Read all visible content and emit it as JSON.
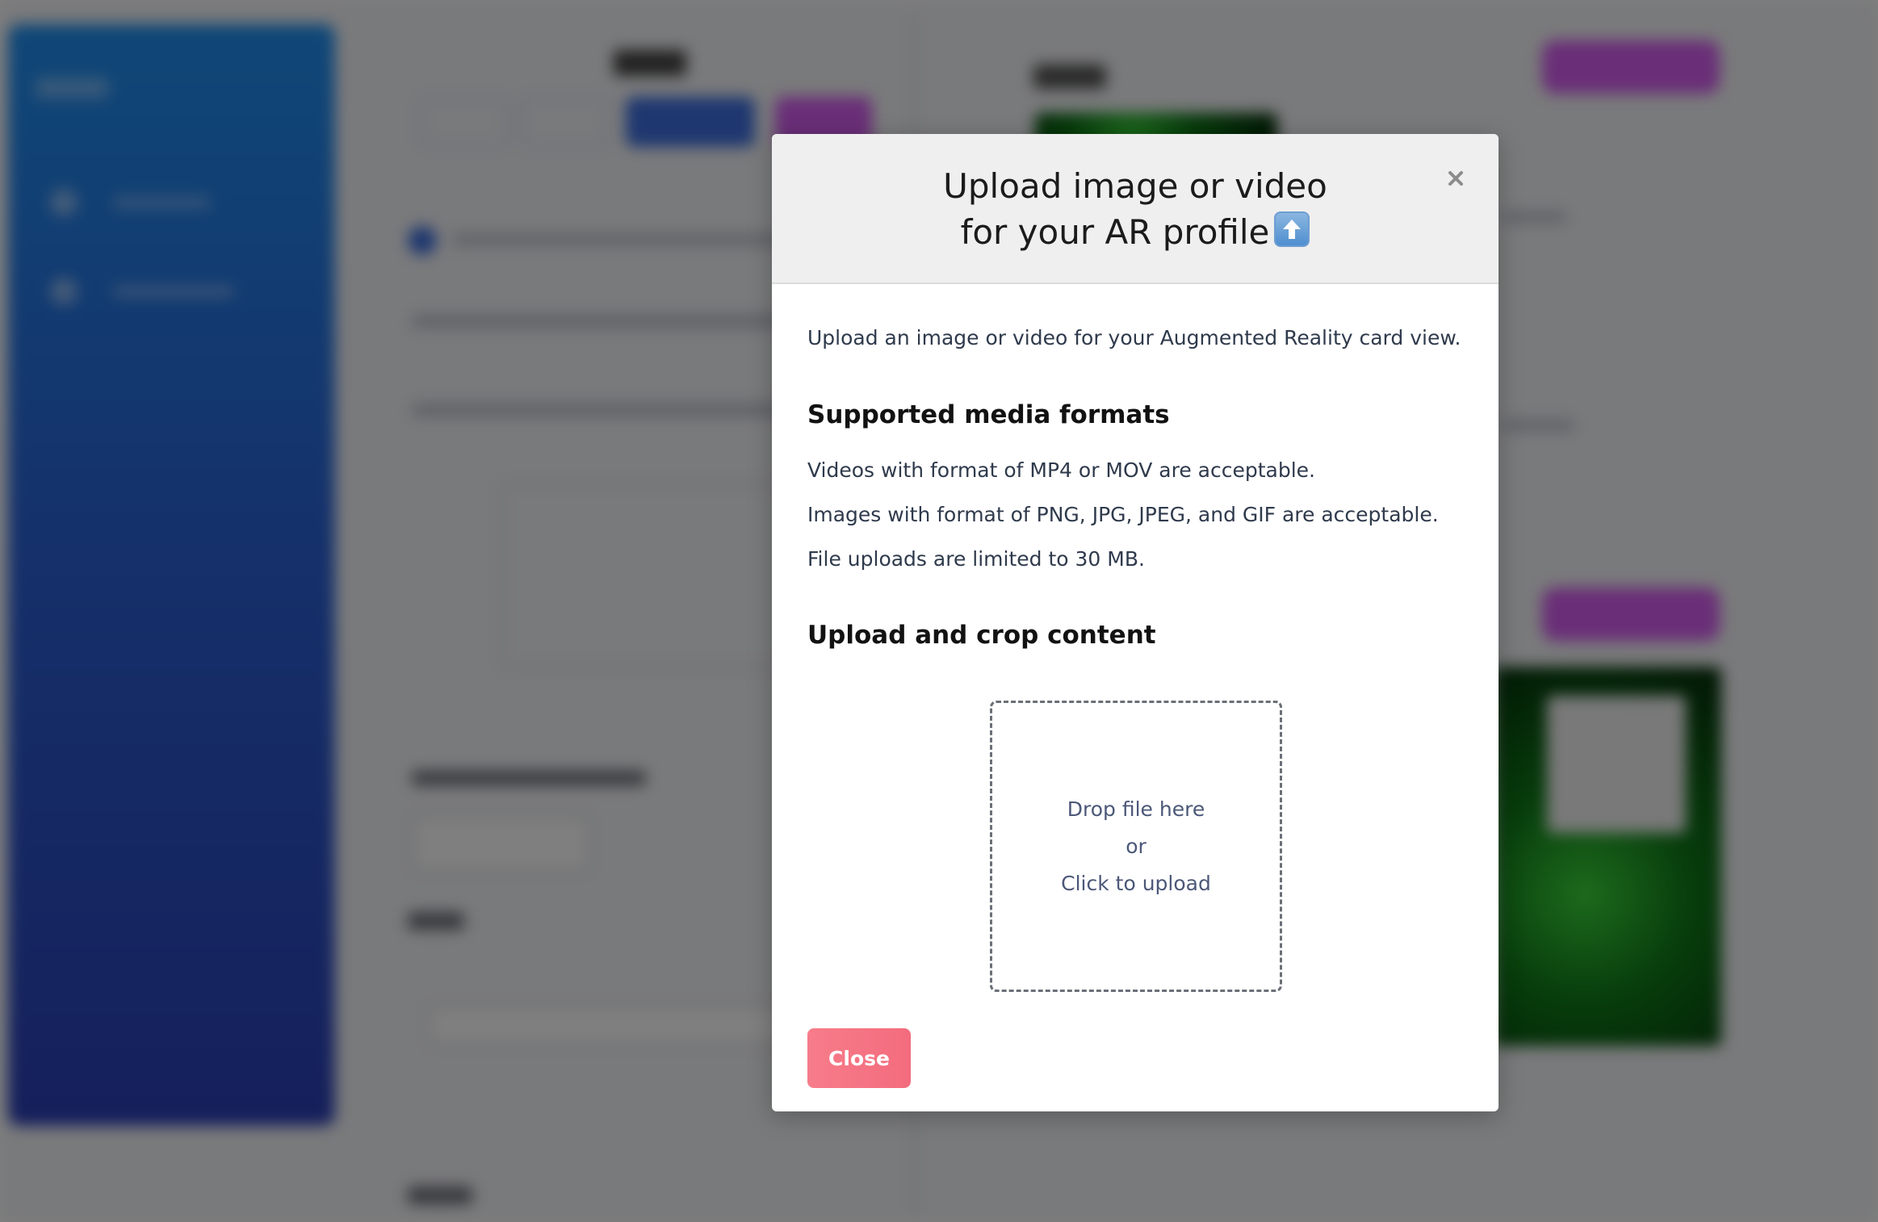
{
  "modal": {
    "title": "Upload image or video\nfor your AR profile",
    "title_icon": "up-arrow-icon",
    "close_icon": "close-icon",
    "intro": "Upload an image or video for your Augmented Reality card view.",
    "formats_heading": "Supported media formats",
    "formats": [
      "Videos with format of MP4 or MOV are acceptable.",
      "Images with format of PNG, JPG, JPEG, and GIF are acceptable.",
      "File uploads are limited to 30 MB."
    ],
    "upload_heading": "Upload and crop content",
    "dropzone": {
      "line1": "Drop file here",
      "line2": "or",
      "line3": "Click to upload"
    },
    "close_button": "Close"
  },
  "colors": {
    "overlay": "#000000",
    "close_button": "#f4727f",
    "header_bg": "#efefef",
    "sidebar": "#2a63d8",
    "accent_pill": "#d45cf0"
  }
}
